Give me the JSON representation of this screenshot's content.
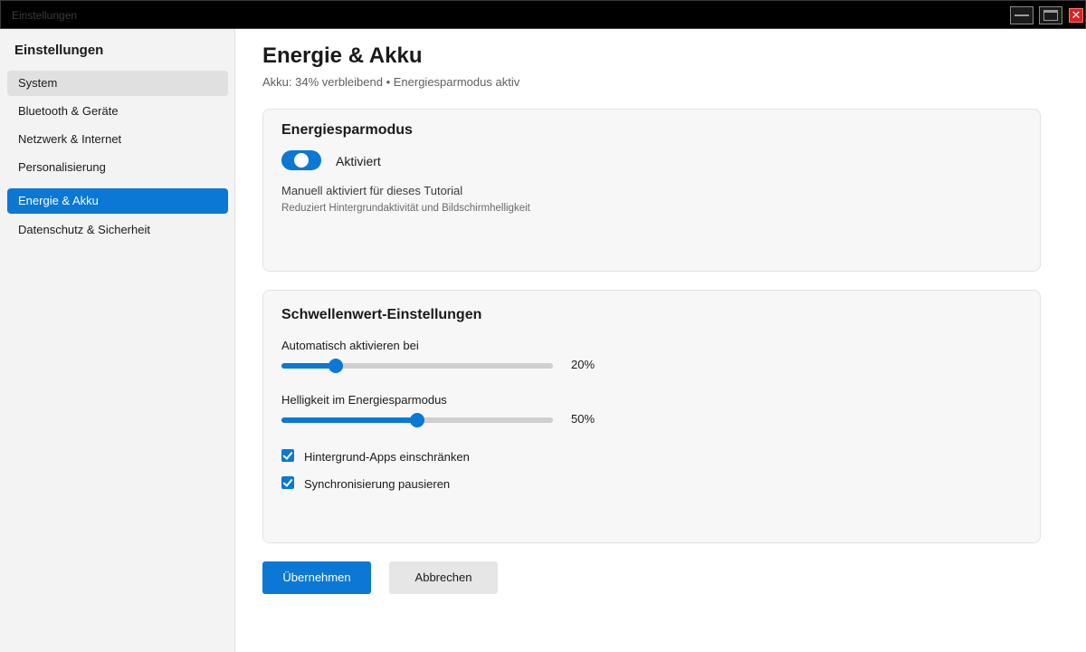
{
  "window": {
    "title": "Einstellungen",
    "close_glyph": "✕"
  },
  "sidebar": {
    "title": "Einstellungen",
    "items": [
      {
        "label": "System"
      },
      {
        "label": "Bluetooth & Geräte"
      },
      {
        "label": "Netzwerk & Internet"
      },
      {
        "label": "Personalisierung"
      },
      {
        "label": "Energie & Akku"
      },
      {
        "label": "Datenschutz & Sicherheit"
      }
    ]
  },
  "main": {
    "title": "Energie & Akku",
    "subtitle": "Akku: 34% verbleibend • Energiesparmodus aktiv",
    "battery_saver": {
      "title": "Energiesparmodus",
      "toggle_on": true,
      "toggle_label": "Aktiviert",
      "note": "Manuell aktiviert für dieses Tutorial",
      "description": "Reduziert Hintergrundaktivität und Bildschirmhelligkeit"
    },
    "thresholds": {
      "title": "Schwellenwert-Einstellungen",
      "auto_activate": {
        "label": "Automatisch aktivieren bei",
        "value_percent": 20,
        "value_text": "20%"
      },
      "brightness": {
        "label": "Helligkeit im Energiesparmodus",
        "value_percent": 50,
        "value_text": "50%"
      },
      "checkboxes": [
        {
          "label": "Hintergrund-Apps einschränken",
          "checked": true
        },
        {
          "label": "Synchronisierung pausieren",
          "checked": true
        }
      ]
    }
  },
  "actions": {
    "apply_label": "Übernehmen",
    "cancel_label": "Abbrechen"
  },
  "colors": {
    "accent": "#0a78d4",
    "close": "#e02020"
  }
}
